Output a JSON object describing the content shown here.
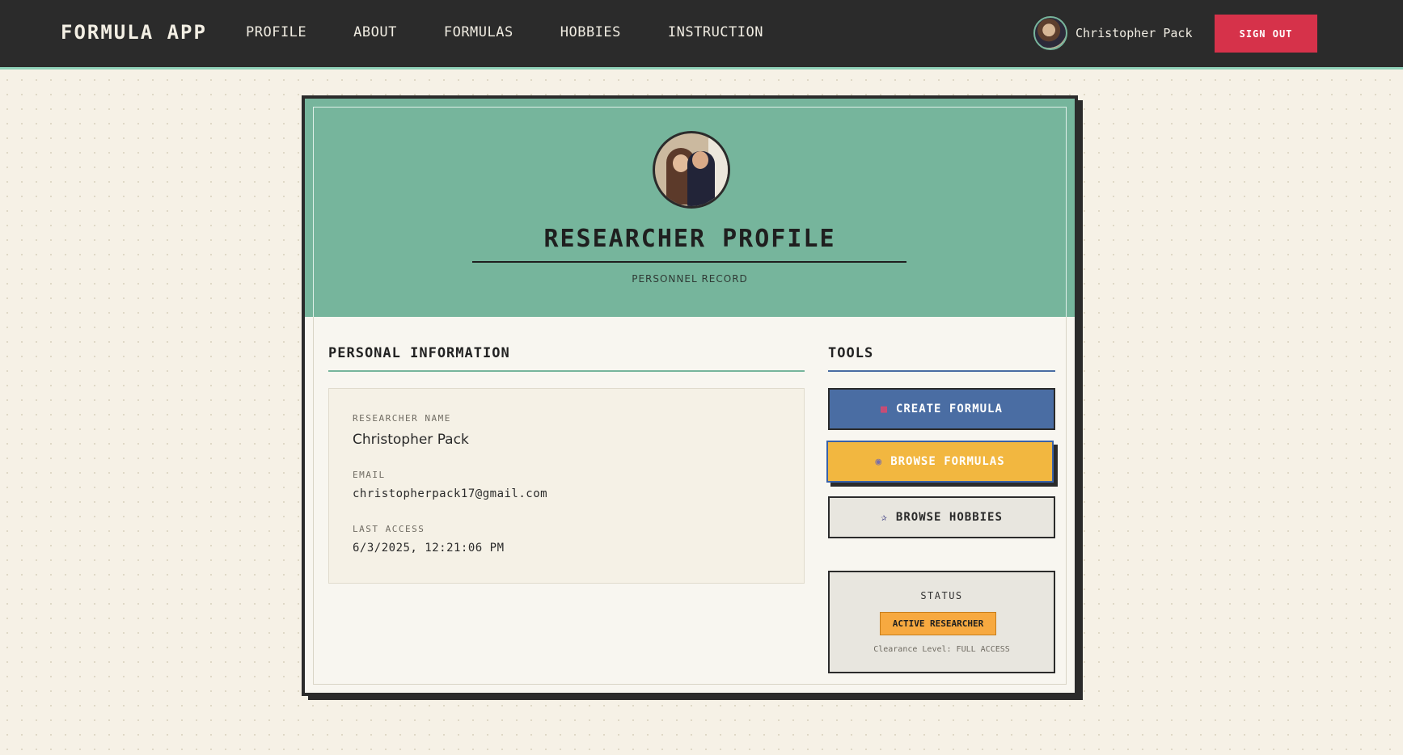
{
  "nav": {
    "brand": "FORMULA APP",
    "links": [
      {
        "label": "PROFILE"
      },
      {
        "label": "ABOUT"
      },
      {
        "label": "FORMULAS"
      },
      {
        "label": "HOBBIES"
      },
      {
        "label": "INSTRUCTION"
      }
    ],
    "user_name": "Christopher Pack",
    "sign_out_label": "SIGN OUT"
  },
  "profile": {
    "title": "RESEARCHER PROFILE",
    "subtitle": "PERSONNEL RECORD"
  },
  "personal_info": {
    "section_title": "PERSONAL INFORMATION",
    "fields": [
      {
        "label": "RESEARCHER NAME",
        "value": "Christopher Pack"
      },
      {
        "label": "EMAIL",
        "value": "christopherpack17@gmail.com"
      },
      {
        "label": "LAST ACCESS",
        "value": "6/3/2025, 12:21:06 PM"
      }
    ]
  },
  "tools": {
    "section_title": "TOOLS",
    "buttons": [
      {
        "label": "CREATE FORMULA",
        "icon": "toolbox-icon"
      },
      {
        "label": "BROWSE FORMULAS",
        "icon": "compass-icon"
      },
      {
        "label": "BROWSE HOBBIES",
        "icon": "telescope-icon"
      }
    ],
    "status": {
      "label": "STATUS",
      "badge": "ACTIVE RESEARCHER",
      "clearance": "Clearance Level: FULL ACCESS"
    }
  },
  "colors": {
    "nav_bg": "#2b2b2b",
    "header_green": "#76b59c",
    "primary_blue": "#4a6da3",
    "accent_yellow": "#f2b740",
    "danger_red": "#d6324a",
    "badge_orange": "#f7a940"
  }
}
